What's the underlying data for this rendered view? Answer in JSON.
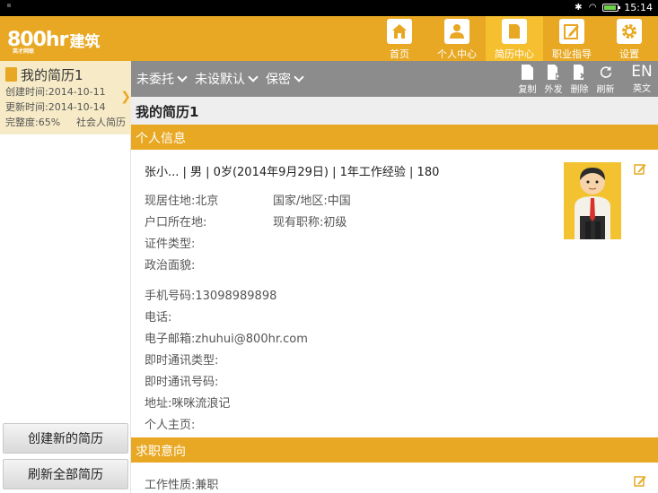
{
  "status_bar": {
    "time": "15:14",
    "bluetooth_icon": "bluetooth-icon",
    "wifi_icon": "wifi-icon",
    "battery_level": 0.9,
    "battery_color": "#6fd04a"
  },
  "header": {
    "logo_mark": "800hr",
    "logo_subtext": "英才网联",
    "logo_text": "建筑",
    "nav": [
      {
        "label": "首页",
        "icon": "home-icon"
      },
      {
        "label": "个人中心",
        "icon": "person-icon"
      },
      {
        "label": "简历中心",
        "icon": "document-icon",
        "active": true
      },
      {
        "label": "职业指导",
        "icon": "edit-icon"
      },
      {
        "label": "设置",
        "icon": "gear-icon"
      }
    ]
  },
  "sidebar": {
    "resume_title": "我的简历1",
    "created": "创建时间:2014-10-11",
    "updated": "更新时间:2014-10-14",
    "completeness": "完整度:65%",
    "resume_type": "社会人简历",
    "create_button": "创建新的简历",
    "refresh_button": "刷新全部简历"
  },
  "toolbar": {
    "filters": [
      "未委托",
      "未设默认",
      "保密"
    ],
    "actions": [
      {
        "label": "复制",
        "icon": "copy-icon"
      },
      {
        "label": "外发",
        "icon": "send-icon"
      },
      {
        "label": "删除",
        "icon": "delete-icon"
      },
      {
        "label": "刷新",
        "icon": "refresh-icon"
      }
    ],
    "lang_code": "EN",
    "lang_label": "英文"
  },
  "content": {
    "resume_heading": "我的简历1",
    "personal_title": "个人信息",
    "summary": "张小... | 男 | 0岁(2014年9月29日) | 1年工作经验 | 180",
    "residence": "现居住地:北京",
    "country": "国家/地区:中国",
    "hukou": "户口所在地:",
    "title_level": "现有职称:初级",
    "id_type": "证件类型:",
    "political": "政治面貌:",
    "mobile": "手机号码:13098989898",
    "phone": "电话:",
    "email": "电子邮箱:zhuhui@800hr.com",
    "im_type": "即时通讯类型:",
    "im_number": "即时通讯号码:",
    "address": "地址:咪咪流浪记",
    "homepage": "个人主页:",
    "intent_title": "求职意向",
    "job_type": "工作性质:兼职"
  },
  "colors": {
    "accent": "#e8a823",
    "toolbar": "#8c8c8c",
    "card": "#f7ebc7"
  }
}
